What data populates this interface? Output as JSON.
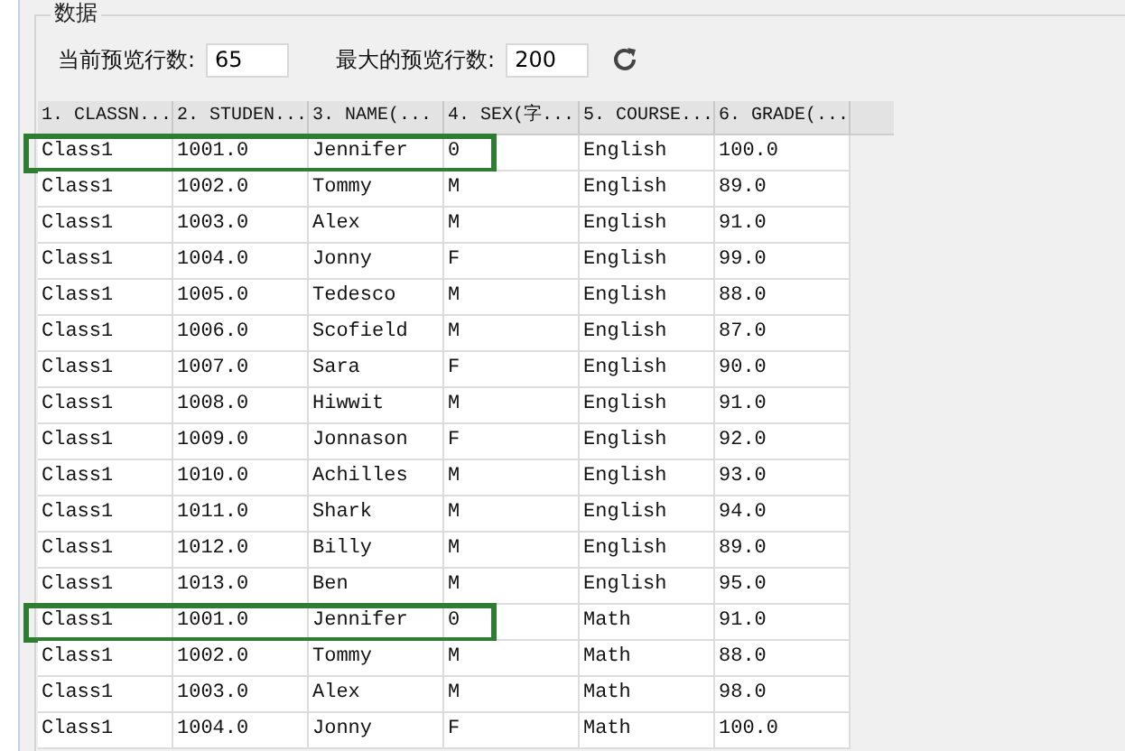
{
  "group": {
    "title": "数据"
  },
  "toolbar": {
    "current_label": "当前预览行数:",
    "current_value": "65",
    "max_label": "最大的预览行数:",
    "max_value": "200"
  },
  "table": {
    "columns": [
      "1. CLASSN...",
      "2. STUDEN...",
      "3. NAME(...",
      "4. SEX(字...",
      "5. COURSE...",
      "6. GRADE(..."
    ],
    "rows": [
      {
        "cells": [
          "Class1",
          "1001.0",
          "Jennifer",
          "0",
          "English",
          "100.0"
        ],
        "highlighted": true
      },
      {
        "cells": [
          "Class1",
          "1002.0",
          "Tommy",
          "M",
          "English",
          "89.0"
        ],
        "highlighted": false
      },
      {
        "cells": [
          "Class1",
          "1003.0",
          "Alex",
          "M",
          "English",
          "91.0"
        ],
        "highlighted": false
      },
      {
        "cells": [
          "Class1",
          "1004.0",
          "Jonny",
          "F",
          "English",
          "99.0"
        ],
        "highlighted": false
      },
      {
        "cells": [
          "Class1",
          "1005.0",
          "Tedesco",
          "M",
          "English",
          "88.0"
        ],
        "highlighted": false
      },
      {
        "cells": [
          "Class1",
          "1006.0",
          "Scofield",
          "M",
          "English",
          "87.0"
        ],
        "highlighted": false
      },
      {
        "cells": [
          "Class1",
          "1007.0",
          "Sara",
          "F",
          "English",
          "90.0"
        ],
        "highlighted": false
      },
      {
        "cells": [
          "Class1",
          "1008.0",
          "Hiwwit",
          "M",
          "English",
          "91.0"
        ],
        "highlighted": false
      },
      {
        "cells": [
          "Class1",
          "1009.0",
          "Jonnason",
          "F",
          "English",
          "92.0"
        ],
        "highlighted": false
      },
      {
        "cells": [
          "Class1",
          "1010.0",
          "Achilles",
          "M",
          "English",
          "93.0"
        ],
        "highlighted": false
      },
      {
        "cells": [
          "Class1",
          "1011.0",
          "Shark",
          "M",
          "English",
          "94.0"
        ],
        "highlighted": false
      },
      {
        "cells": [
          "Class1",
          "1012.0",
          "Billy",
          "M",
          "English",
          "89.0"
        ],
        "highlighted": false
      },
      {
        "cells": [
          "Class1",
          "1013.0",
          "Ben",
          "M",
          "English",
          "95.0"
        ],
        "highlighted": false
      },
      {
        "cells": [
          "Class1",
          "1001.0",
          "Jennifer",
          "0",
          "Math",
          "91.0"
        ],
        "highlighted": true
      },
      {
        "cells": [
          "Class1",
          "1002.0",
          "Tommy",
          "M",
          "Math",
          "88.0"
        ],
        "highlighted": false
      },
      {
        "cells": [
          "Class1",
          "1003.0",
          "Alex",
          "M",
          "Math",
          "98.0"
        ],
        "highlighted": false
      },
      {
        "cells": [
          "Class1",
          "1004.0",
          "Jonny",
          "F",
          "Math",
          "100.0"
        ],
        "highlighted": false
      }
    ]
  }
}
